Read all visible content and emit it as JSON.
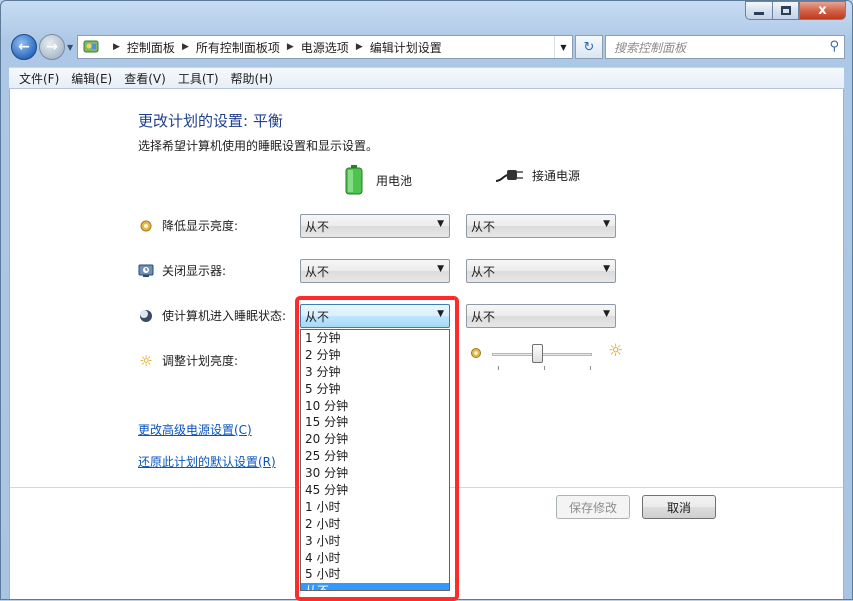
{
  "window": {
    "caption_close": "x",
    "breadcrumb": [
      "控制面板",
      "所有控制面板项",
      "电源选项",
      "编辑计划设置"
    ],
    "search_placeholder": "搜索控制面板"
  },
  "menu": [
    "文件(F)",
    "编辑(E)",
    "查看(V)",
    "工具(T)",
    "帮助(H)"
  ],
  "page": {
    "title": "更改计划的设置: 平衡",
    "subtitle": "选择希望计算机使用的睡眠设置和显示设置。",
    "col_battery": "用电池",
    "col_plugged": "接通电源",
    "rows": [
      {
        "label": "降低显示亮度:",
        "battery": "从不",
        "plugged": "从不"
      },
      {
        "label": "关闭显示器:",
        "battery": "从不",
        "plugged": "从不"
      },
      {
        "label": "使计算机进入睡眠状态:",
        "battery": "从不",
        "plugged": "从不"
      }
    ],
    "brightness_label": "调整计划亮度:",
    "brightness_plugged_level": 0.45,
    "link_advanced": "更改高级电源设置(C)",
    "link_restore": "还原此计划的默认设置(R)",
    "btn_save": "保存修改",
    "btn_cancel": "取消"
  },
  "dropdown": {
    "options": [
      "1 分钟",
      "2 分钟",
      "3 分钟",
      "5 分钟",
      "10 分钟",
      "15 分钟",
      "20 分钟",
      "25 分钟",
      "30 分钟",
      "45 分钟",
      "1 小时",
      "2 小时",
      "3 小时",
      "4 小时",
      "5 小时",
      "从不"
    ],
    "selected": "从不"
  },
  "colors": {
    "accent": "#3399ff",
    "highlight_box": "#ff2a2a",
    "title": "#1f3f8f",
    "link": "#0a55bd"
  }
}
